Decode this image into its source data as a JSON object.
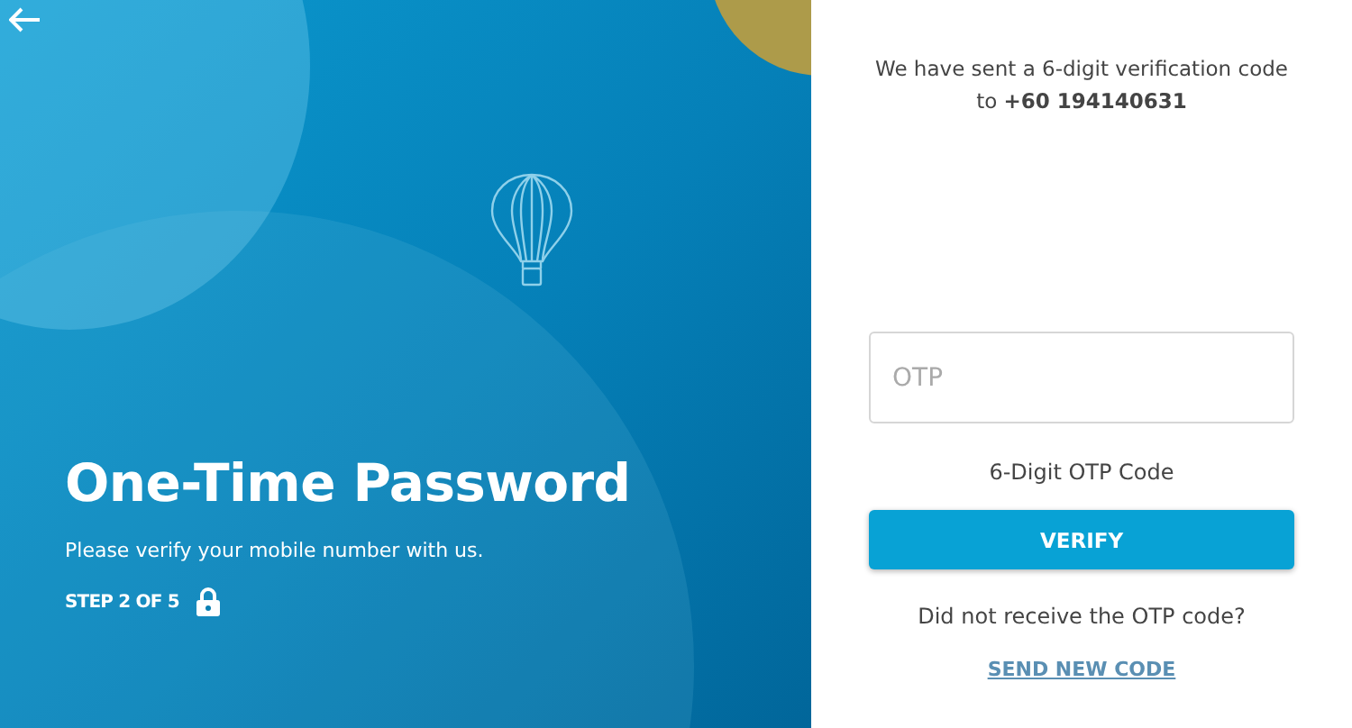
{
  "hero": {
    "title": "One-Time Password",
    "subtitle": "Please verify your mobile number with us.",
    "step": "STEP 2 OF 5"
  },
  "form": {
    "message": "We have sent a 6-digit verification code to **+60 194140631**",
    "otp_field": {
      "placeholder": "OTP"
    },
    "field_hint": "6-Digit OTP Code",
    "verify_button": "VERIFY",
    "resend_prompt": "Did not receive the OTP code?",
    "resend_link": "SEND NEW CODE"
  }
}
